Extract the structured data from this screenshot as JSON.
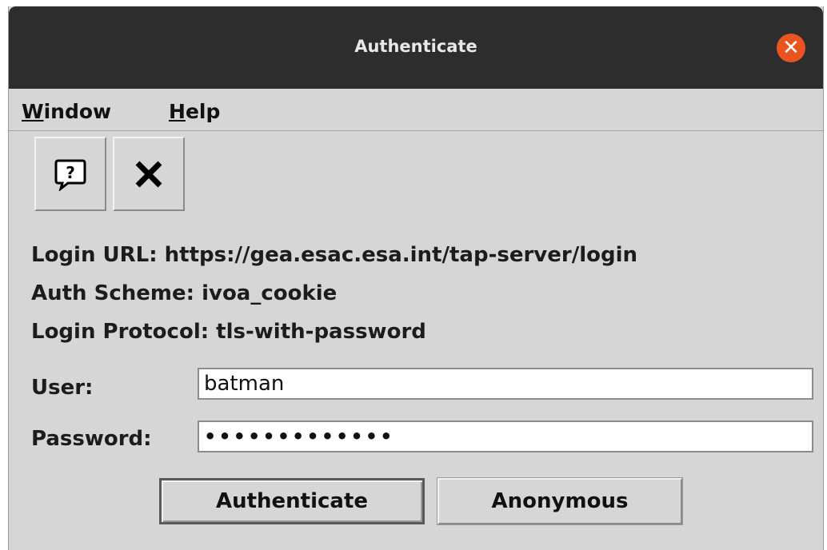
{
  "window": {
    "title": "Authenticate"
  },
  "menu": {
    "items": [
      {
        "mnemonic": "W",
        "rest": "indow"
      },
      {
        "mnemonic": "H",
        "rest": "elp"
      }
    ]
  },
  "toolbar": {
    "buttons": [
      {
        "icon": "help-bubble-icon"
      },
      {
        "icon": "close-x-icon"
      }
    ]
  },
  "info": {
    "login_url": "Login URL: https://gea.esac.esa.int/tap-server/login",
    "auth_scheme": "Auth Scheme: ivoa_cookie",
    "login_protocol": "Login Protocol: tls-with-password"
  },
  "form": {
    "user_label": "User:",
    "user_value": "batman",
    "password_label": "Password:",
    "password_value": "•••••••••••••"
  },
  "buttons": {
    "authenticate": "Authenticate",
    "anonymous": "Anonymous"
  },
  "colors": {
    "title_bar": "#2d2d2d",
    "close_button": "#e95420",
    "window_bg": "#d6d6d6"
  }
}
